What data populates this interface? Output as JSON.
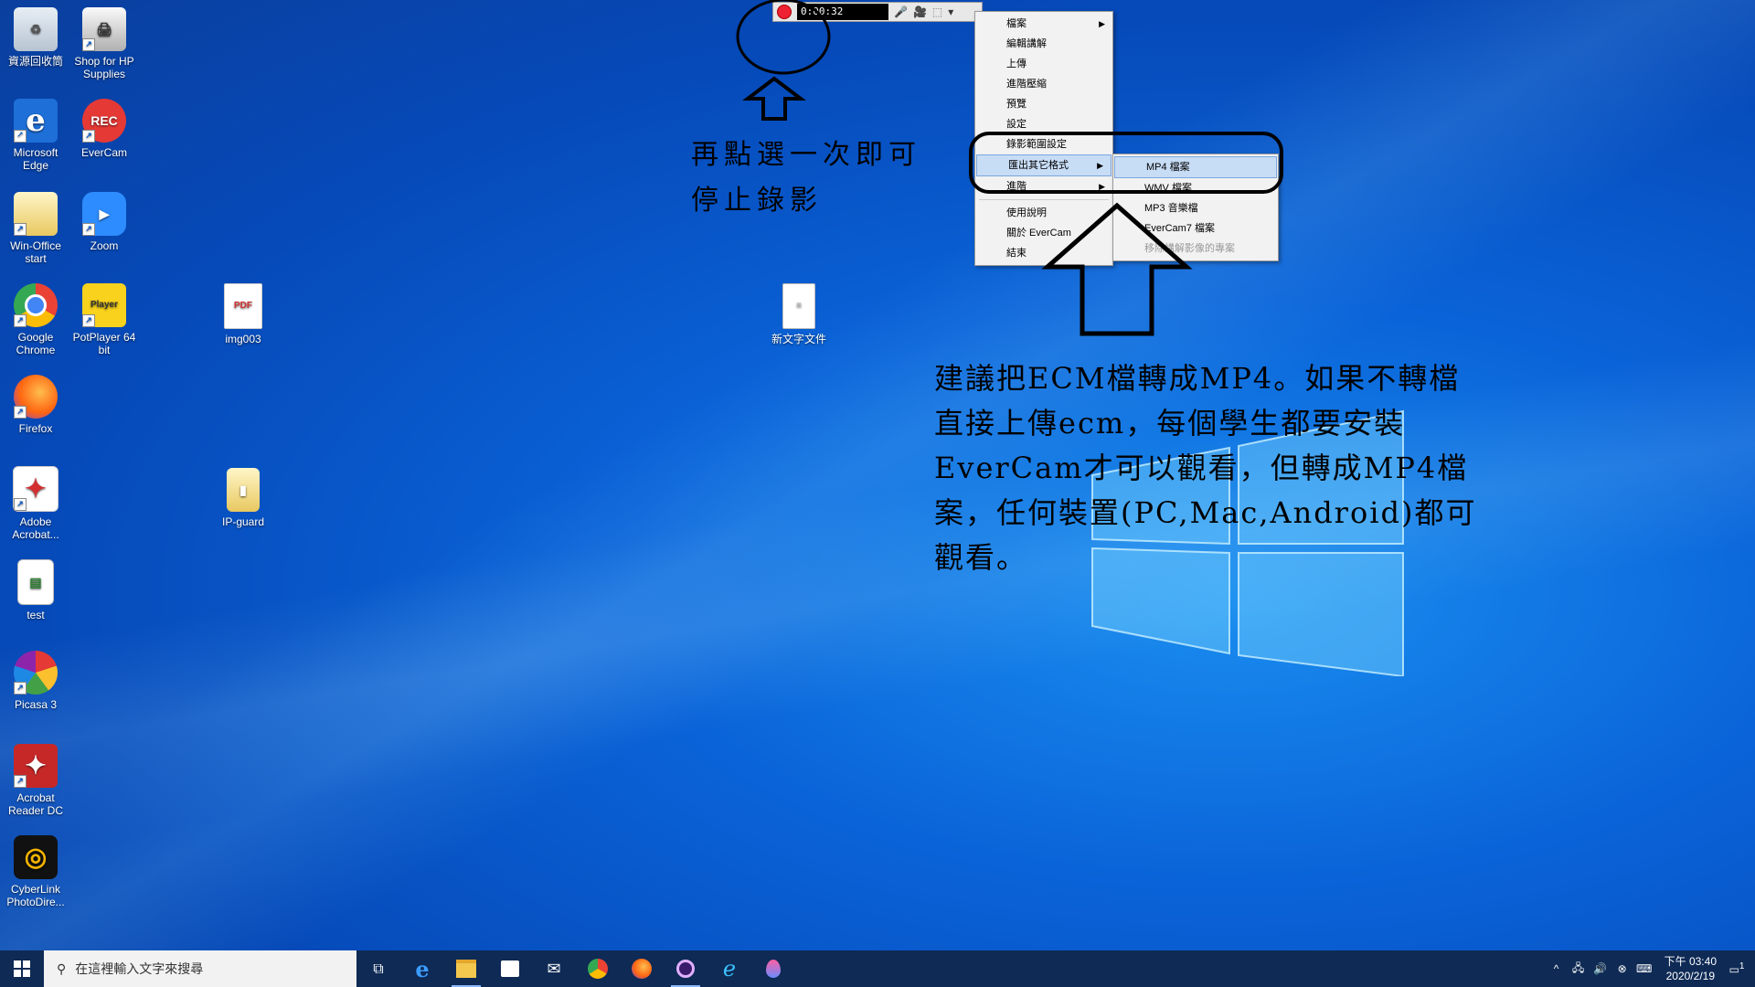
{
  "desktop": {
    "icons": [
      {
        "label": "資源回收筒",
        "icon": "recycle-bin-icon"
      },
      {
        "label": "Shop for HP Supplies",
        "icon": "printer-icon"
      },
      {
        "label": "Microsoft Edge",
        "icon": "edge-icon"
      },
      {
        "label": "EverCam",
        "icon": "evercam-icon",
        "badge": "REC"
      },
      {
        "label": "Win-Office start",
        "icon": "folder-icon"
      },
      {
        "label": "Zoom",
        "icon": "zoom-icon"
      },
      {
        "label": "Google Chrome",
        "icon": "chrome-icon"
      },
      {
        "label": "PotPlayer 64 bit",
        "icon": "potplayer-icon",
        "badge": "Player"
      },
      {
        "label": "img003",
        "icon": "pdf-file-icon",
        "badge": "PDF"
      },
      {
        "label": "新文字文件",
        "icon": "text-file-icon"
      },
      {
        "label": "Firefox",
        "icon": "firefox-icon"
      },
      {
        "label": "Adobe Acrobat...",
        "icon": "acrobat-icon"
      },
      {
        "label": "IP-guard",
        "icon": "folder-zip-icon"
      },
      {
        "label": "test",
        "icon": "document-icon"
      },
      {
        "label": "Picasa 3",
        "icon": "picasa-icon"
      },
      {
        "label": "Acrobat Reader DC",
        "icon": "acrobat-reader-icon"
      },
      {
        "label": "CyberLink PhotoDire...",
        "icon": "cyberlink-icon"
      }
    ]
  },
  "recorder": {
    "timer": "0:00:32",
    "mic_icon": "microphone-icon",
    "cam_icon": "camera-icon",
    "area_icon": "select-area-icon",
    "dropdown_icon": "chevron-down-icon"
  },
  "menu": {
    "items": [
      {
        "label": "檔案",
        "sub": true
      },
      {
        "label": "編輯講解"
      },
      {
        "label": "上傳"
      },
      {
        "label": "進階壓縮"
      },
      {
        "label": "預覽"
      },
      {
        "label": "設定"
      },
      {
        "label": "錄影範圍設定"
      },
      {
        "label": "匯出其它格式",
        "sub": true,
        "selected": true
      },
      {
        "label": "進階",
        "sub": true
      },
      {
        "label": "使用說明"
      },
      {
        "label": "關於 EverCam"
      },
      {
        "label": "結束"
      }
    ],
    "submenu": [
      {
        "label": "MP4 檔案",
        "selected": true
      },
      {
        "label": "WMV 檔案"
      },
      {
        "label": "MP3 音樂檔"
      },
      {
        "label": "EverCam7 檔案"
      },
      {
        "label": "移除講解影像的專案",
        "disabled": true
      }
    ]
  },
  "annotations": {
    "stop_hint_line1": "再點選一次即可",
    "stop_hint_line2": "停止錄影",
    "advice": "建議把ECM檔轉成MP4。如果不轉檔直接上傳ecm，每個學生都要安裝EverCam才可以觀看，但轉成MP4檔案，任何裝置(PC,Mac,Android)都可觀看。"
  },
  "taskbar": {
    "search_placeholder": "在這裡輸入文字來搜尋",
    "apps": [
      "task-view-icon",
      "edge-icon",
      "file-explorer-icon",
      "store-icon",
      "mail-icon",
      "chrome-icon",
      "firefox-icon",
      "evercam-icon",
      "ie-icon",
      "maps-icon"
    ],
    "clock_time": "下午 03:40",
    "clock_date": "2020/2/19",
    "notification_count": "1"
  },
  "colors": {
    "wallpaper": "#0a63d8",
    "taskbar": "#0e2a55",
    "menu_selected": "#c7dcf5",
    "record_red": "#e22233"
  }
}
